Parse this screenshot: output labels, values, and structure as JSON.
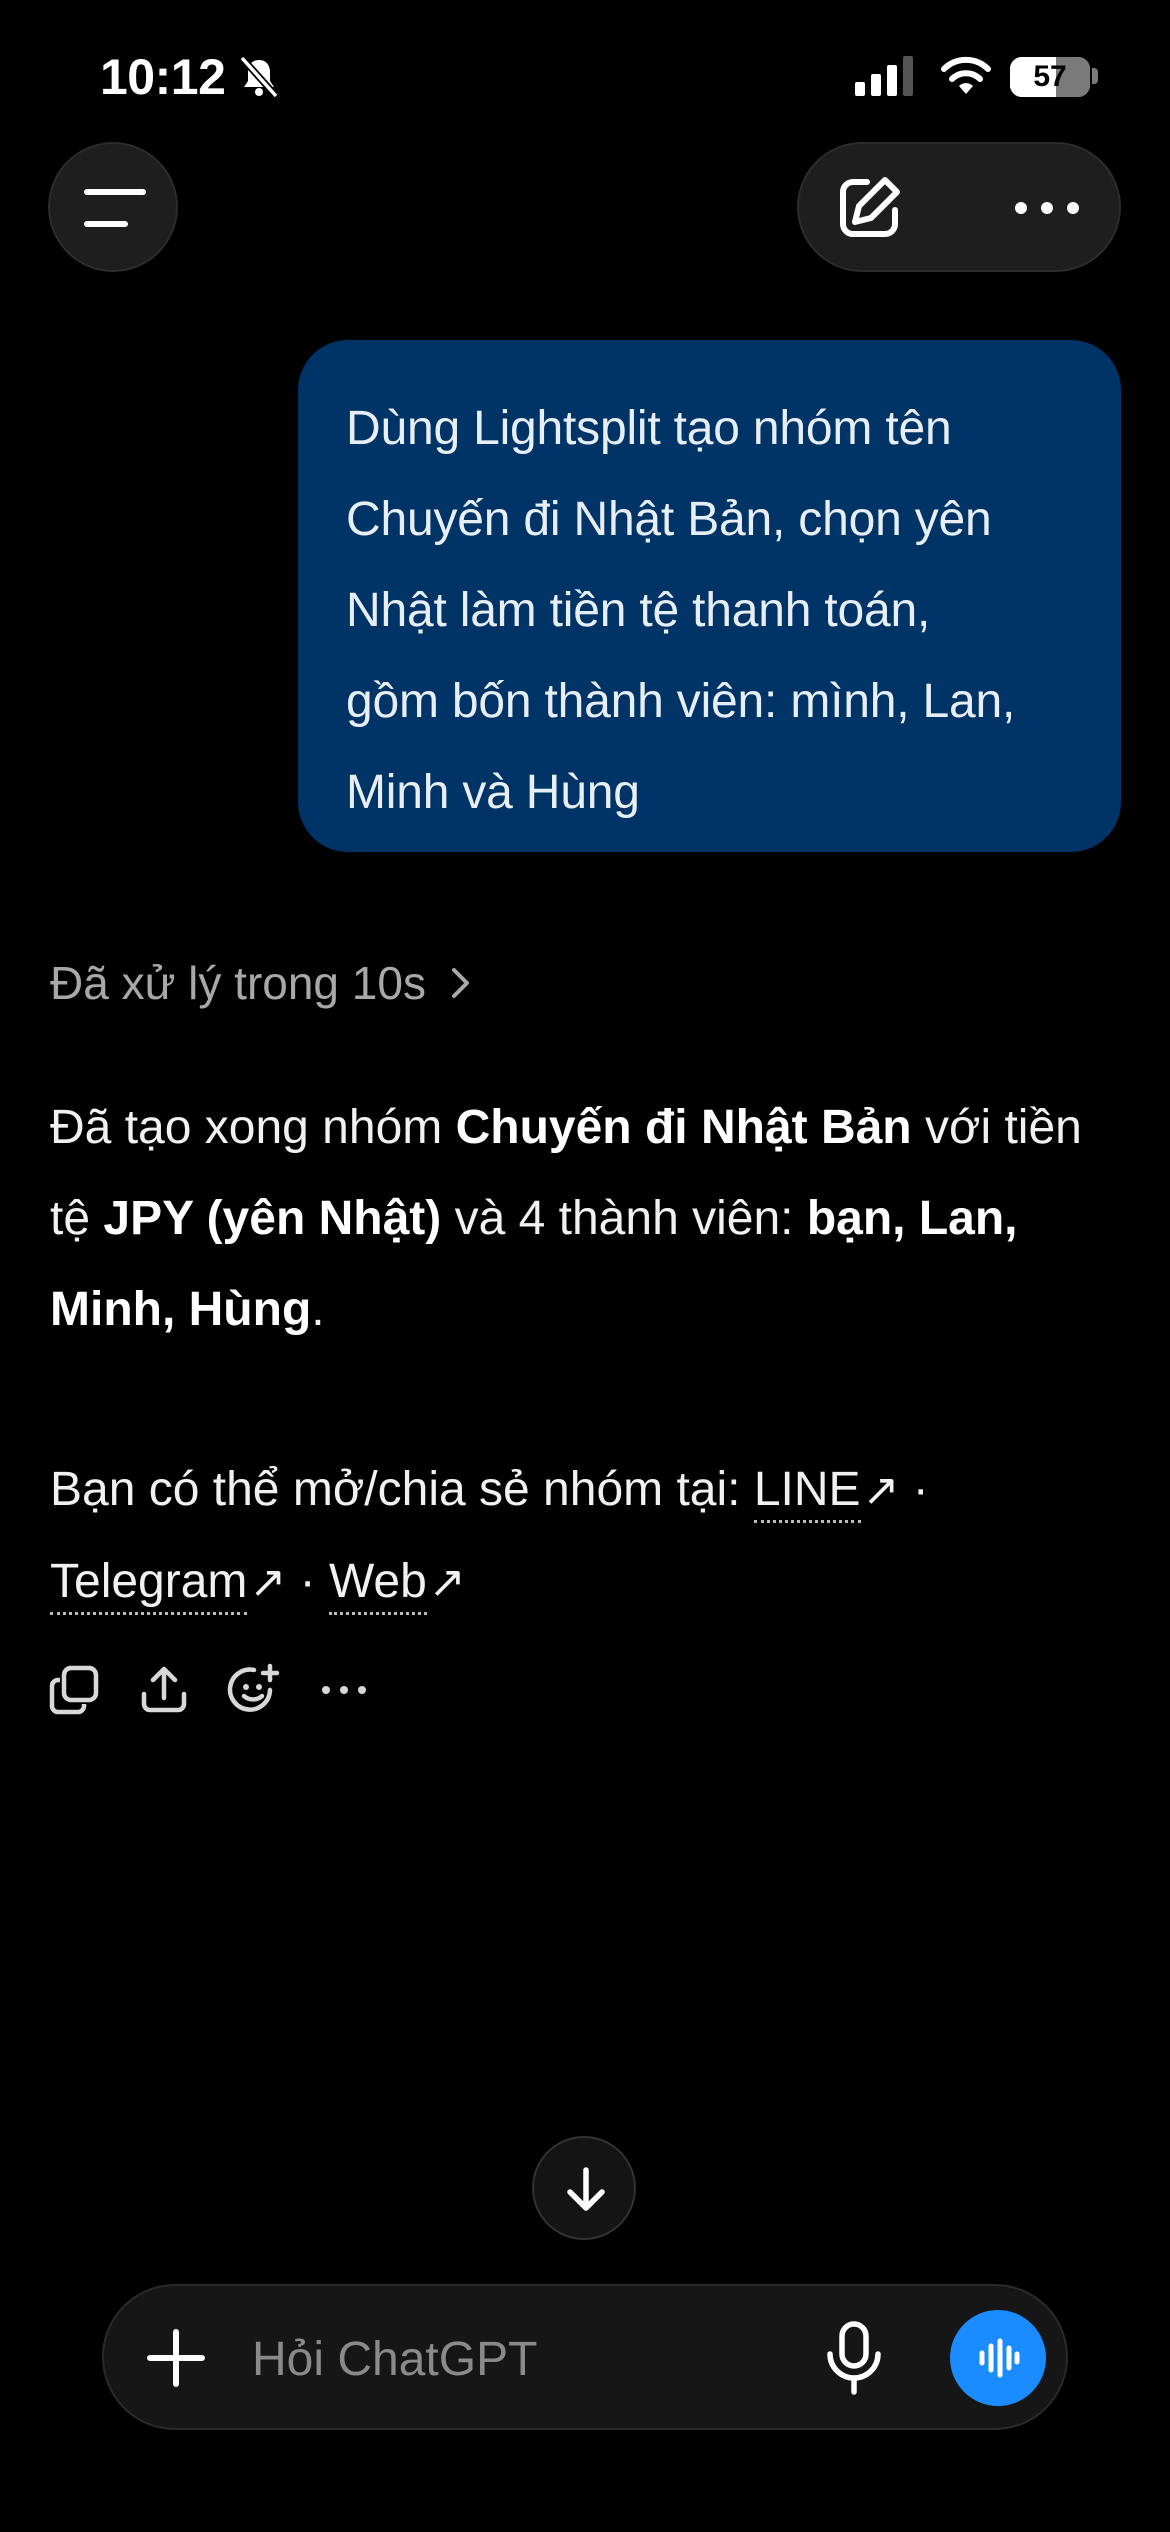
{
  "status_bar": {
    "time": "10:12",
    "battery": "57",
    "battery_level_percent": 57
  },
  "header": {
    "menu_icon": "hamburger-icon",
    "new_chat_icon": "edit-icon",
    "more_icon": "more-horizontal-icon"
  },
  "conversation": {
    "user_message_lines": [
      "Dùng Lightsplit tạo nhóm tên",
      "Chuyến đi Nhật Bản, chọn yên",
      "Nhật làm tiền tệ thanh toán,",
      "gồm bốn thành viên: mình, Lan,",
      "Minh và Hùng"
    ],
    "processed_label": "Đã xử lý trong 10s",
    "answer": {
      "p1_prefix": "Đã tạo xong nhóm ",
      "p1_group": "Chuyến đi Nhật Bản",
      "p1_mid": " với tiền tệ ",
      "p1_currency": "JPY (yên Nhật)",
      "p1_mid2": " và 4 thành viên: ",
      "p1_members": "bạn, Lan, Minh, Hùng",
      "p1_end": ".",
      "p2_prefix": "Bạn có thể mở/chia sẻ nhóm tại: ",
      "links": [
        "LINE",
        "Telegram",
        "Web"
      ],
      "link_arrow": "↗",
      "separator": " · "
    },
    "actions": [
      "copy-icon",
      "share-icon",
      "add-reaction-icon",
      "more-horizontal-icon"
    ]
  },
  "composer": {
    "placeholder": "Hỏi ChatGPT",
    "voice_accent": "#1a8cff"
  }
}
